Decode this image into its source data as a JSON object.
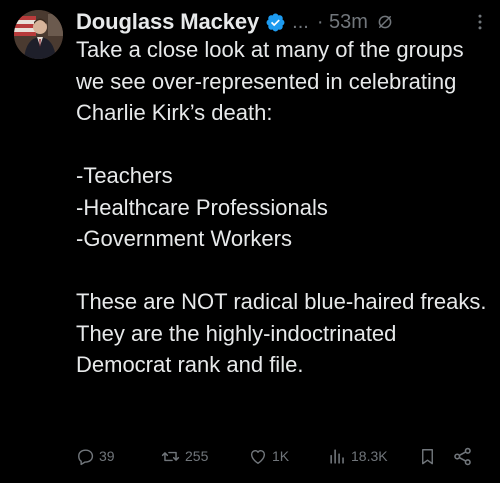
{
  "post": {
    "author": {
      "name": "Douglass Mackey",
      "handle_truncated": "...",
      "verified": true,
      "avatar": "avatar-photo"
    },
    "timestamp": "· 53m",
    "body": {
      "intro": "Take a close look at many of the groups we see over-represented in celebrating Charlie Kirk’s death:",
      "list": [
        "-Teachers",
        "-Healthcare Professionals",
        "-Government Workers"
      ],
      "closing": "These are NOT radical blue-haired freaks. They are the highly-indoctrinated Democrat rank and file."
    },
    "actions": {
      "reply_count": "39",
      "repost_count": "255",
      "like_count": "1K",
      "view_count": "18.3K"
    }
  },
  "icons": {
    "verified": "verified-badge-icon",
    "grok": "grok-icon",
    "more": "more-options-icon",
    "reply": "reply-icon",
    "repost": "repost-icon",
    "like": "heart-icon",
    "views": "views-chart-icon",
    "bookmark": "bookmark-icon",
    "share": "share-icon"
  },
  "colors": {
    "background": "#000000",
    "text_primary": "#e7e9ea",
    "text_secondary": "#71767b",
    "verified_blue": "#1d9bf0"
  }
}
